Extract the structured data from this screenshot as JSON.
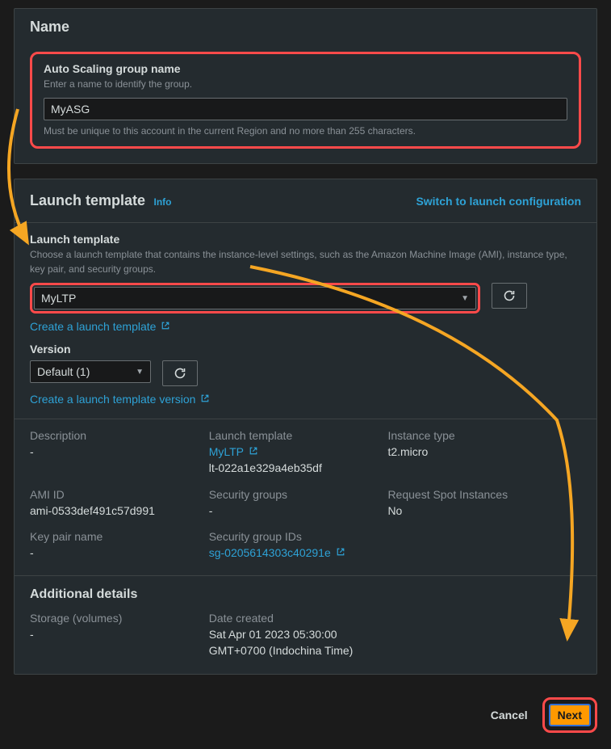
{
  "name_section": {
    "title": "Name",
    "field_label": "Auto Scaling group name",
    "field_hint": "Enter a name to identify the group.",
    "value": "MyASG",
    "below_hint": "Must be unique to this account in the current Region and no more than 255 characters."
  },
  "lt_section": {
    "title": "Launch template",
    "info": "Info",
    "switch": "Switch to launch configuration",
    "field_label": "Launch template",
    "field_hint": "Choose a launch template that contains the instance-level settings, such as the Amazon Machine Image (AMI), instance type, key pair, and security groups.",
    "selected": "MyLTP",
    "create_link": "Create a launch template",
    "version_label": "Version",
    "version_selected": "Default (1)",
    "create_version_link": "Create a launch template version"
  },
  "details": {
    "description": {
      "label": "Description",
      "value": "-"
    },
    "launch_template": {
      "label": "Launch template",
      "link": "MyLTP",
      "id": "lt-022a1e329a4eb35df"
    },
    "instance_type": {
      "label": "Instance type",
      "value": "t2.micro"
    },
    "ami_id": {
      "label": "AMI ID",
      "value": "ami-0533def491c57d991"
    },
    "security_groups": {
      "label": "Security groups",
      "value": "-"
    },
    "request_spot": {
      "label": "Request Spot Instances",
      "value": "No"
    },
    "key_pair": {
      "label": "Key pair name",
      "value": "-"
    },
    "sg_ids": {
      "label": "Security group IDs",
      "link": "sg-0205614303c40291e"
    }
  },
  "additional": {
    "title": "Additional details",
    "storage": {
      "label": "Storage (volumes)",
      "value": "-"
    },
    "date_created": {
      "label": "Date created",
      "value1": "Sat Apr 01 2023 05:30:00",
      "value2": "GMT+0700 (Indochina Time)"
    }
  },
  "footer": {
    "cancel": "Cancel",
    "next": "Next"
  }
}
